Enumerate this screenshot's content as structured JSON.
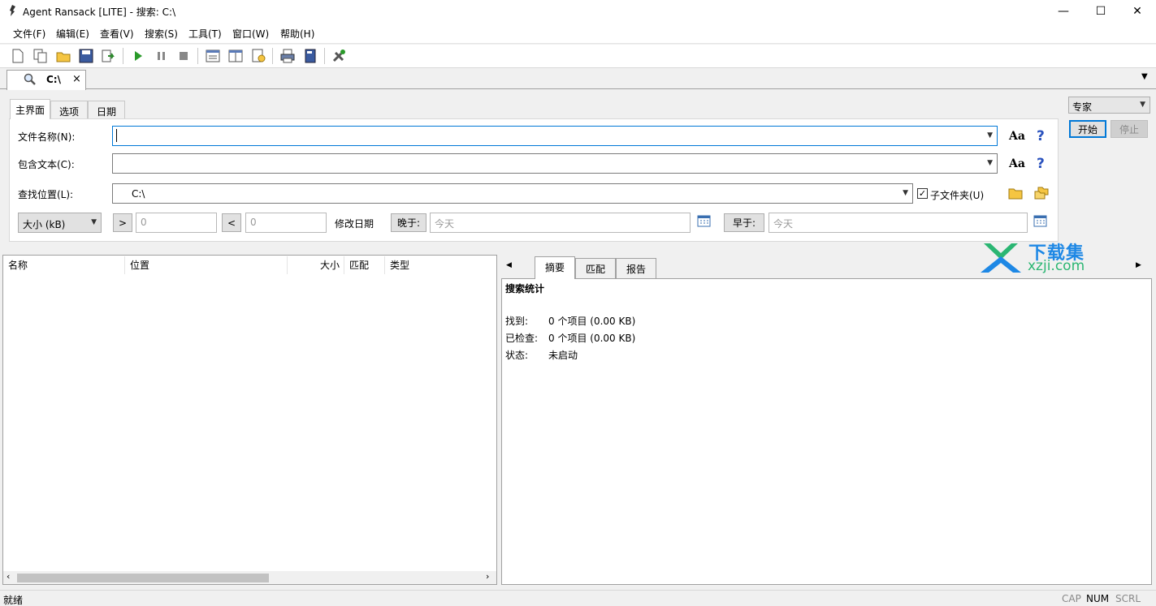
{
  "window": {
    "title": "Agent Ransack [LITE] - 搜索: C:\\",
    "minimize": "—",
    "maximize": "☐",
    "close": "✕"
  },
  "menu": [
    "文件(F)",
    "编辑(E)",
    "查看(V)",
    "搜索(S)",
    "工具(T)",
    "窗口(W)",
    "帮助(H)"
  ],
  "toolbar_icons": [
    "new-icon",
    "copy-icon",
    "open-icon",
    "save-icon",
    "export-icon",
    "play-icon",
    "pause-icon",
    "stop-icon",
    "layout1-icon",
    "layout2-icon",
    "report-icon",
    "print-icon",
    "book-icon",
    "tools-icon"
  ],
  "doc_tab": {
    "label": "C:\\",
    "close": "×"
  },
  "panel_tabs": [
    "主界面",
    "选项",
    "日期"
  ],
  "mode": {
    "selected": "专家"
  },
  "buttons": {
    "start": "开始",
    "stop": "停止"
  },
  "form": {
    "filename_label": "文件名称(N):",
    "filename_value": "",
    "content_label": "包含文本(C):",
    "content_value": "",
    "location_label": "查找位置(L):",
    "location_value": "C:\\",
    "subfolders_label": "子文件夹(U)",
    "subfolders_checked": true,
    "case_glyph": "Aa",
    "help_glyph": "?",
    "size_select": "大小 (kB)",
    "gt_label": ">",
    "gt_value": "0",
    "lt_label": "<",
    "lt_value": "0",
    "modified_label": "修改日期",
    "after_label": "晚于:",
    "after_value": "今天",
    "before_label": "早于:",
    "before_value": "今天"
  },
  "results": {
    "columns": [
      "名称",
      "位置",
      "大小",
      "匹配",
      "类型"
    ]
  },
  "right_tabs": [
    "摘要",
    "匹配",
    "报告"
  ],
  "summary": {
    "heading": "搜索统计",
    "rows": [
      {
        "label": "找到:",
        "value": "0 个项目 (0.00 KB)"
      },
      {
        "label": "已检查:",
        "value": "0 个项目 (0.00 KB)"
      },
      {
        "label": "状态:",
        "value": "未启动"
      }
    ]
  },
  "watermark": {
    "text": "下载集",
    "sub": "xzji.com"
  },
  "status": {
    "text": "就绪",
    "cap": "CAP",
    "num": "NUM",
    "scrl": "SCRL"
  },
  "colors": {
    "accent": "#0078d7",
    "watermark_green": "#2bb673",
    "watermark_blue": "#1e88e5"
  }
}
